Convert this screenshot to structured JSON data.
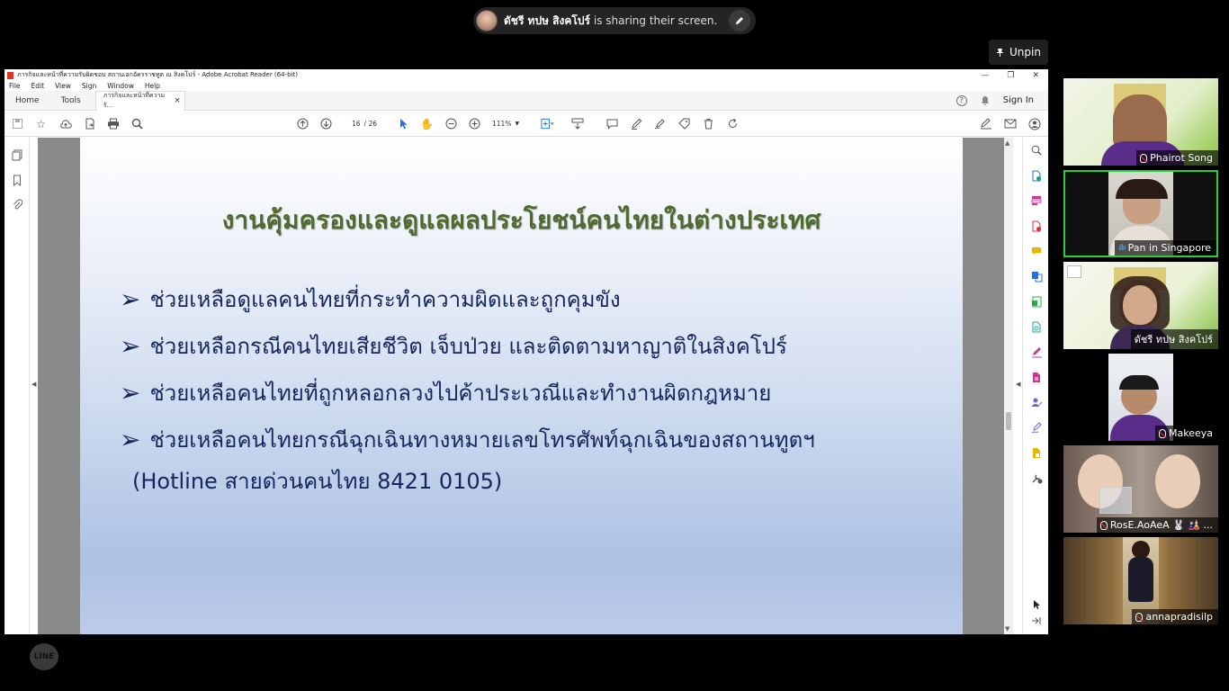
{
  "share_banner": {
    "presenter_name": "ดัชรี ทปษ สิงคโปร์",
    "message": "is sharing their screen."
  },
  "unpin_label": "Unpin",
  "acrobat": {
    "window_title": "ภารกิจและหน้าที่ความรับผิดชอบ สถานเอกอัครราชทูต ณ สิงคโปร์ - Adobe Acrobat Reader (64-bit)",
    "menu": [
      "File",
      "Edit",
      "View",
      "Sign",
      "Window",
      "Help"
    ],
    "tabs": {
      "home": "Home",
      "tools": "Tools",
      "document": "ภารกิจและหน้าที่ความรั..."
    },
    "sign_in": "Sign In",
    "page_current": "16",
    "page_total": "/ 26",
    "zoom": "111%"
  },
  "slide": {
    "title": "งานคุ้มครองและดูแลผลประโยชน์คนไทยในต่างประเทศ",
    "bullets": [
      "ช่วยเหลือดูแลคนไทยที่กระทำความผิดและถูกคุมขัง",
      "ช่วยเหลือกรณีคนไทยเสียชีวิต เจ็บป่วย และติดตามหาญาติในสิงคโปร์",
      "ช่วยเหลือคนไทยที่ถูกหลอกลวงไปค้าประเวณีและทำงานผิดกฎหมาย",
      "ช่วยเหลือคนไทยกรณีฉุกเฉินทางหมายเลขโทรศัพท์ฉุกเฉินของสถานทูตฯ"
    ],
    "hotline": "(Hotline สายด่วนคนไทย 8421 0105)"
  },
  "participants": [
    {
      "name": "Phairot Song",
      "muted": true
    },
    {
      "name": "Pan in Singapore",
      "muted": false,
      "speaking": true
    },
    {
      "name": "ดัชรี ทปษ สิงคโปร์",
      "muted": false
    },
    {
      "name": "Makeeya",
      "muted": true
    },
    {
      "name": "RosE.AoAeA 🐰 🎎 ...",
      "muted": true
    },
    {
      "name": "annapradisilp",
      "muted": true
    }
  ],
  "line_logo": "LINE",
  "colors": {
    "slide_title": "#4e6a2e",
    "slide_text": "#13275e",
    "active_speaker_border": "#2ecc40"
  }
}
